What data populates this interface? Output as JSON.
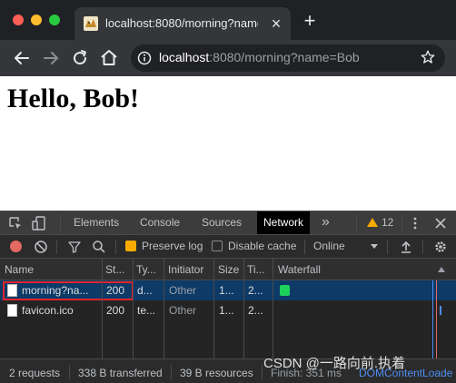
{
  "browser": {
    "tab": {
      "title": "localhost:8080/morning?name=B"
    },
    "url": {
      "host": "localhost",
      "rest": ":8080/morning?name=Bob"
    }
  },
  "page": {
    "heading": "Hello, Bob!"
  },
  "devtools": {
    "tabs": [
      {
        "label": "Elements"
      },
      {
        "label": "Console"
      },
      {
        "label": "Sources"
      },
      {
        "label": "Network"
      }
    ],
    "more_label": "»",
    "warning_count": "12",
    "network_toolbar": {
      "preserve_log_label": "Preserve log",
      "preserve_log_checked": true,
      "disable_cache_label": "Disable cache",
      "disable_cache_checked": false,
      "throttling": "Online"
    },
    "columns": [
      "Name",
      "St...",
      "Ty...",
      "Initiator",
      "Size",
      "Ti...",
      "Waterfall"
    ],
    "rows": [
      {
        "name": "morning?na...",
        "status": "200",
        "type": "d...",
        "initiator": "Other",
        "size": "1...",
        "time": "2..."
      },
      {
        "name": "favicon.ico",
        "status": "200",
        "type": "te...",
        "initiator": "Other",
        "size": "1...",
        "time": "2..."
      }
    ],
    "status_bar": {
      "requests": "2 requests",
      "transferred": "338 B transferred",
      "resources": "39 B resources",
      "finish": "Finish: 351 ms",
      "dom_loaded": "DOMContentLoade"
    },
    "watermark": "CSDN @一路向前.执着"
  },
  "colors": {
    "selected_row": "#0d3a67",
    "highlight_box": "#e0242b",
    "waterfall_bar": "#1dd15d",
    "warning": "#f9ab00"
  }
}
